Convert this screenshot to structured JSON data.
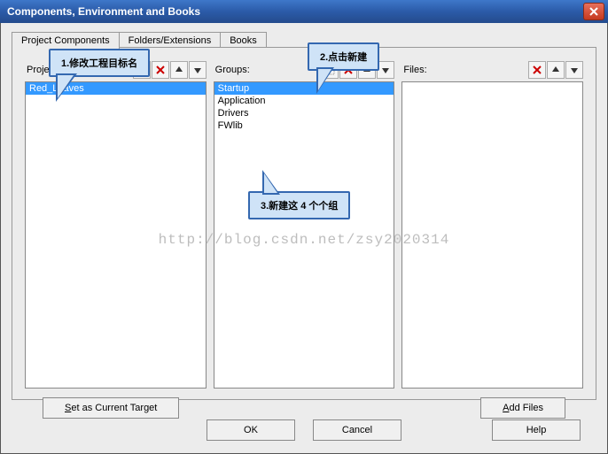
{
  "window": {
    "title": "Components, Environment and Books"
  },
  "tabs": {
    "items": [
      {
        "label": "Project Components"
      },
      {
        "label": "Folders/Extensions"
      },
      {
        "label": "Books"
      }
    ]
  },
  "columns": {
    "targets": {
      "label": "Project Targets:",
      "items": [
        "Red_Leaves"
      ],
      "selected": 0
    },
    "groups": {
      "label": "Groups:",
      "items": [
        "Startup",
        "Application",
        "Drivers",
        "FWlib"
      ],
      "selected": 0
    },
    "files": {
      "label": "Files:",
      "items": []
    }
  },
  "buttons": {
    "set_target": "Set as Current Target",
    "add_files": "Add Files",
    "ok": "OK",
    "cancel": "Cancel",
    "help": "Help"
  },
  "callouts": {
    "c1": "1.修改工程目标名",
    "c2": "2.点击新建",
    "c3": "3.新建这 4 个个组"
  },
  "watermark": "http://blog.csdn.net/zsy2020314"
}
